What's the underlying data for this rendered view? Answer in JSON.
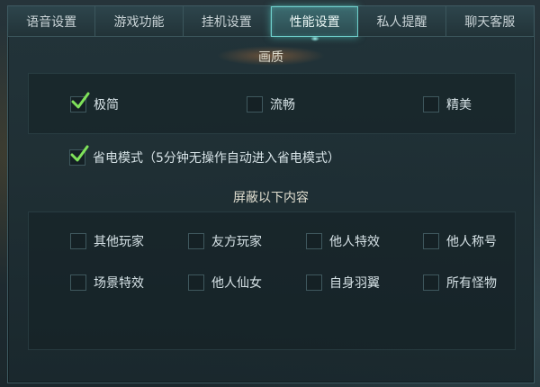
{
  "tabs": [
    {
      "label": "语音设置",
      "active": false
    },
    {
      "label": "游戏功能",
      "active": false
    },
    {
      "label": "挂机设置",
      "active": false
    },
    {
      "label": "性能设置",
      "active": true
    },
    {
      "label": "私人提醒",
      "active": false
    },
    {
      "label": "聊天客服",
      "active": false
    }
  ],
  "quality": {
    "title": "画质",
    "options": [
      {
        "label": "极简",
        "checked": true
      },
      {
        "label": "流畅",
        "checked": false
      },
      {
        "label": "精美",
        "checked": false
      }
    ]
  },
  "power_save": {
    "label": "省电模式（5分钟无操作自动进入省电模式）",
    "checked": true
  },
  "block": {
    "title": "屏蔽以下内容",
    "options": [
      {
        "label": "其他玩家",
        "checked": false
      },
      {
        "label": "友方玩家",
        "checked": false
      },
      {
        "label": "他人特效",
        "checked": false
      },
      {
        "label": "他人称号",
        "checked": false
      },
      {
        "label": "场景特效",
        "checked": false
      },
      {
        "label": "他人仙女",
        "checked": false
      },
      {
        "label": "自身羽翼",
        "checked": false
      },
      {
        "label": "所有怪物",
        "checked": false
      }
    ]
  },
  "colors": {
    "accent": "#6fd0cc",
    "check": "#7fe25a"
  }
}
